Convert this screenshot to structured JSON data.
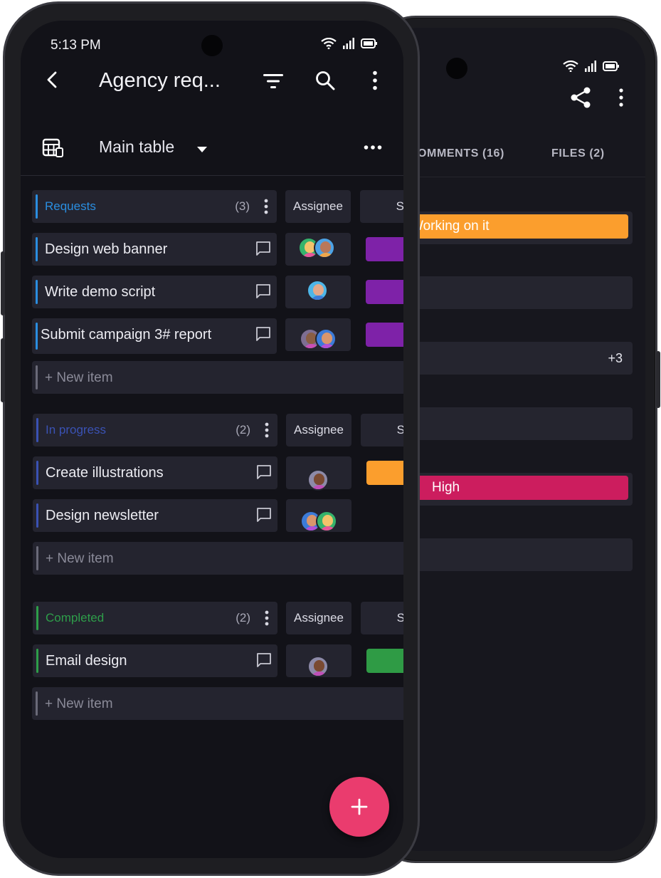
{
  "colors": {
    "requests": "#2a8ee0",
    "in_progress": "#3a52b4",
    "completed": "#2e9e4a",
    "status_purple": "#7e22a8",
    "status_orange": "#fb9e2d",
    "status_green": "#2f9b45",
    "priority_high": "#cc1d5e",
    "fab": "#ea3c6e"
  },
  "back_screen": {
    "tabs": [
      "OMMENTS (16)",
      "FILES (2)"
    ],
    "status_value": "Working on it",
    "people_extra": "+3",
    "priority_value": "High"
  },
  "status_bar": {
    "time": "5:13 PM"
  },
  "appbar": {
    "title": "Agency req..."
  },
  "table_bar": {
    "view_name": "Main table"
  },
  "groups": [
    {
      "name": "Requests",
      "count": "(3)",
      "col_assignee": "Assignee",
      "col_status_fragment": "S",
      "items": [
        "Design web banner",
        "Write demo script",
        "Submit campaign 3# report"
      ],
      "new_item": "+ New item"
    },
    {
      "name": "In progress",
      "count": "(2)",
      "col_assignee": "Assignee",
      "col_status_fragment": "S",
      "items": [
        "Create illustrations",
        "Design newsletter"
      ],
      "new_item": "+ New item"
    },
    {
      "name": "Completed",
      "count": "(2)",
      "col_assignee": "Assignee",
      "col_status_fragment": "S",
      "items": [
        "Email design"
      ],
      "new_item": "+ New item"
    }
  ],
  "fab": {
    "label": "+"
  }
}
